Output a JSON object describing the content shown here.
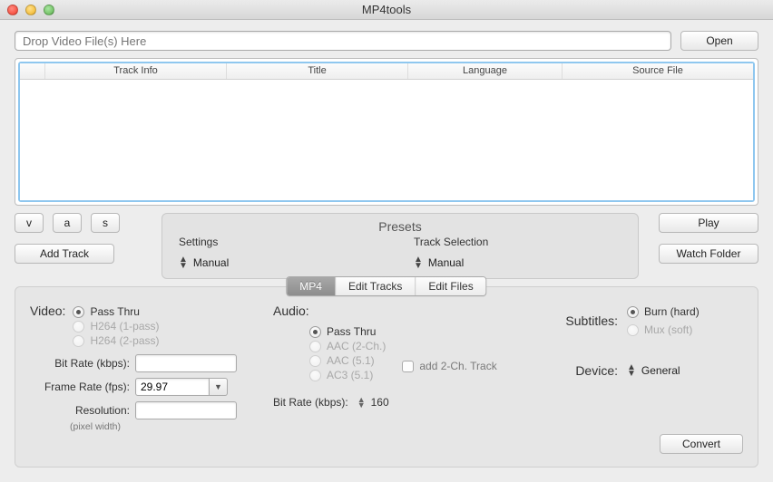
{
  "window": {
    "title": "MP4tools"
  },
  "toolbar": {
    "drop_placeholder": "Drop Video File(s) Here",
    "open_label": "Open"
  },
  "table": {
    "headers": {
      "check": "",
      "info": "Track Info",
      "title": "Title",
      "language": "Language",
      "source": "Source File"
    }
  },
  "vas": {
    "v": "v",
    "a": "a",
    "s": "s"
  },
  "add_track_label": "Add Track",
  "presets": {
    "title": "Presets",
    "settings_label": "Settings",
    "settings_value": "Manual",
    "trackselection_label": "Track Selection",
    "trackselection_value": "Manual"
  },
  "right_buttons": {
    "play": "Play",
    "watch_folder": "Watch Folder"
  },
  "tabs": {
    "mp4": "MP4",
    "edit_tracks": "Edit Tracks",
    "edit_files": "Edit Files"
  },
  "video": {
    "label": "Video:",
    "options": {
      "passthru": "Pass Thru",
      "h264_1": "H264 (1-pass)",
      "h264_2": "H264 (2-pass)"
    },
    "bitrate_label": "Bit Rate (kbps):",
    "framerate_label": "Frame Rate (fps):",
    "framerate_value": "29.97",
    "resolution_label": "Resolution:",
    "resolution_hint": "(pixel width)"
  },
  "audio": {
    "label": "Audio:",
    "options": {
      "passthru": "Pass Thru",
      "aac2": "AAC (2-Ch.)",
      "aac51": "AAC (5.1)",
      "ac351": "AC3 (5.1)"
    },
    "add2ch_label": "add 2-Ch. Track",
    "bitrate_label": "Bit Rate (kbps):",
    "bitrate_value": "160"
  },
  "subtitles": {
    "label": "Subtitles:",
    "options": {
      "burn": "Burn (hard)",
      "mux": "Mux (soft)"
    }
  },
  "device": {
    "label": "Device:",
    "value": "General"
  },
  "convert_label": "Convert"
}
